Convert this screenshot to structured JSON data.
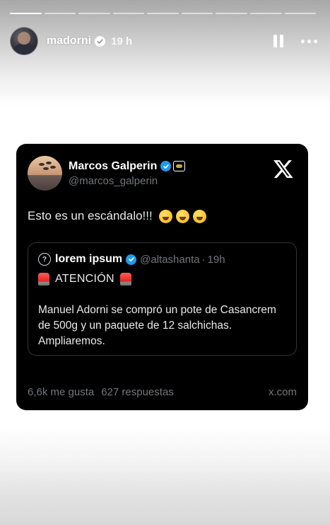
{
  "story": {
    "progress": {
      "segments": 9,
      "active_index": 0
    },
    "username": "madorni",
    "time_ago": "19 h"
  },
  "tweet": {
    "author_name": "Marcos Galperin",
    "author_handle": "@marcos_galperin",
    "text": "Esto es un escándalo!!!",
    "emojis": [
      "rolling-on-floor-laughing",
      "rolling-on-floor-laughing",
      "rolling-on-floor-laughing"
    ],
    "quoted": {
      "name": "lorem ipsum",
      "handle": "@altashanta",
      "separator": "·",
      "time": "19h",
      "alert": "ATENCIÓN",
      "body": "Manuel Adorni se compró un pote de Casancrem de 500g y un paquete de 12 salchichas. Ampliaremos."
    },
    "likes": "6,6k me gusta",
    "replies": "627 respuestas",
    "site": "x.com"
  },
  "colors": {
    "verified_blue": "#1d9bf0",
    "card_bg": "#000000",
    "muted_text": "#71767b"
  }
}
